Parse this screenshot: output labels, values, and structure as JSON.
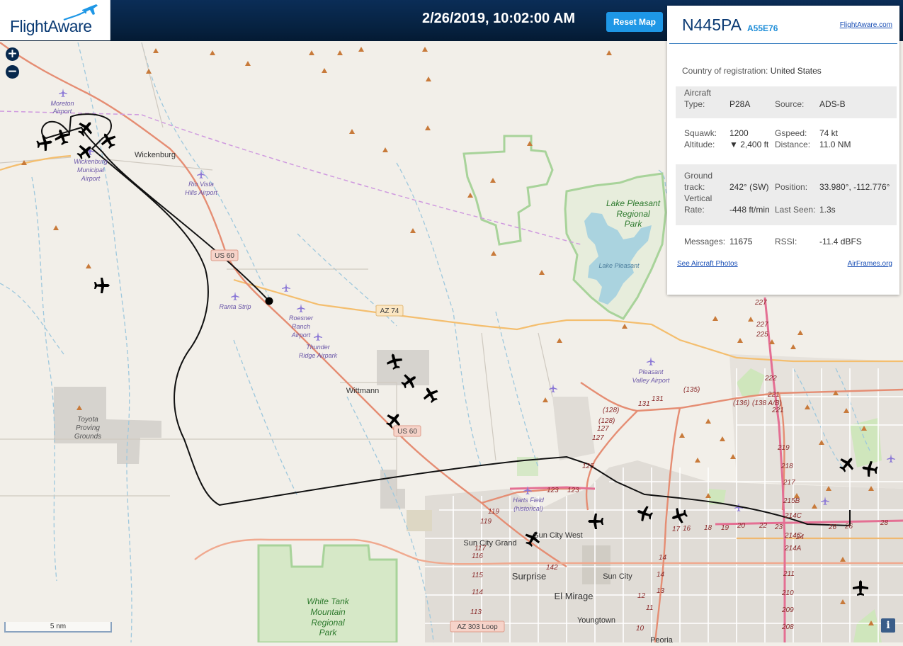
{
  "header": {
    "logo_text": "FlightAware",
    "datetime": "2/26/2019, 10:02:00 AM",
    "reset_label": "Reset Map"
  },
  "zoom": {
    "in_label": "+",
    "out_label": "−"
  },
  "panel": {
    "registration": "N445PA",
    "hex": "A55E76",
    "flightaware_link": "FlightAware.com",
    "country_label": "Country of registration:",
    "country_value": "United States",
    "aircraft_label_1": "Aircraft",
    "aircraft_label_2": "Type:",
    "aircraft_type": "P28A",
    "source_label": "Source:",
    "source_value": "ADS-B",
    "squawk_label": "Squawk:",
    "squawk_value": "1200",
    "gspeed_label": "Gspeed:",
    "gspeed_value": "74 kt",
    "altitude_label": "Altitude:",
    "altitude_value": "▼ 2,400 ft",
    "distance_label": "Distance:",
    "distance_value": "11.0 NM",
    "ground_label_1": "Ground",
    "ground_label_2": "track:",
    "ground_value": "242° (SW)",
    "position_label": "Position:",
    "position_value": "33.980°, -112.776°",
    "vertical_label_1": "Vertical",
    "vertical_label_2": "Rate:",
    "vertical_value": "-448 ft/min",
    "lastseen_label": "Last Seen:",
    "lastseen_value": "1.3s",
    "messages_label": "Messages:",
    "messages_value": "11675",
    "rssi_label": "RSSI:",
    "rssi_value": "-11.4 dBFS",
    "photos_link": "See Aircraft Photos",
    "airframes_link": "AirFrames.org"
  },
  "scale_label": "5 nm",
  "info_label": "i",
  "map": {
    "places": {
      "wickenburg": "Wickenburg",
      "wittmann": "Wittmann",
      "sun_city_grand": "Sun City Grand",
      "sun_city_west": "Sun City West",
      "surprise": "Surprise",
      "el_mirage": "El Mirage",
      "sun_city": "Sun City",
      "youngtown": "Youngtown",
      "peoria": "Peoria"
    },
    "airports": {
      "moreton_1": "Moreton",
      "moreton_2": "Airport",
      "wick_1": "Wickenburg",
      "wick_2": "Municipal",
      "wick_3": "Airport",
      "rio_1": "Rio Vista",
      "rio_2": "Hills Airport",
      "ranta": "Ranta Strip",
      "roesner_1": "Roesner",
      "roesner_2": "Ranch",
      "roesner_3": "Airport",
      "thunder_1": "Thunder",
      "thunder_2": "Ridge Airpark",
      "pleasant_1": "Pleasant",
      "pleasant_2": "Valley Airport",
      "harts_1": "Harts Field",
      "harts_2": "(historical)"
    },
    "areas": {
      "lake_1": "Lake Pleasant",
      "lake_2": "Regional",
      "lake_3": "Park",
      "lake_water": "Lake Pleasant",
      "toyota_1": "Toyota",
      "toyota_2": "Proving",
      "toyota_3": "Grounds",
      "white_1": "White Tank",
      "white_2": "Mountain",
      "white_3": "Regional",
      "white_4": "Park"
    },
    "shields": {
      "us60_a": "US 60",
      "us60_b": "US 60",
      "az74": "AZ 74",
      "az303": "AZ 303 Loop"
    },
    "road_numbers": {
      "r227": "227",
      "r225": "225",
      "r222": "222",
      "r221a": "221",
      "r221b": "221",
      "r219": "219",
      "r218": "218",
      "r217": "217",
      "r215b": "215B",
      "r214c_a": "214C",
      "r214c_b": "214C",
      "r214a": "214A",
      "r211": "211",
      "r210": "210",
      "r209": "209",
      "r208": "208",
      "r24": "24",
      "r135a": "(135)",
      "r131a": "131",
      "r131b": "131",
      "r128a": "(128)",
      "r128b": "(128)",
      "r127a": "127",
      "r127b": "127",
      "r125": "125",
      "r123a": "123",
      "r123b": "123",
      "r136": "(136)",
      "r138": "(138 A/B)",
      "r119a": "119",
      "r119b": "119",
      "r117": "117",
      "r116": "116",
      "r115": "115",
      "r114": "114",
      "r113": "113",
      "r142": "142",
      "r14": "14",
      "r13": "13",
      "r12": "12",
      "r11": "11",
      "r10": "10",
      "r16": "16",
      "r17": "17",
      "r18": "18",
      "r19": "19",
      "r20": "20",
      "r22": "22",
      "r23": "23",
      "r26": "26",
      "r28": "28"
    }
  }
}
